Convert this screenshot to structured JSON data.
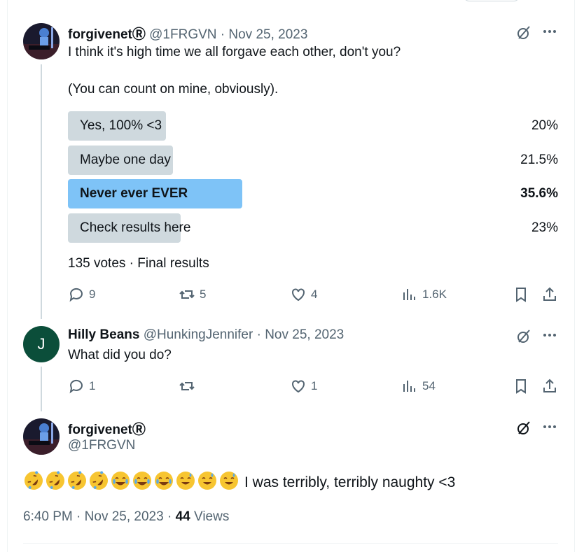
{
  "tweets": [
    {
      "name": "forgivenetⓇ",
      "handle": "@1FRGVN",
      "date": "Nov 25, 2023",
      "text_lines": [
        "I think it's high time we all forgave each other, don't you?",
        "(You can count on mine, obviously)."
      ],
      "poll": {
        "options": [
          {
            "label": "Yes, 100% <3",
            "percent": "20%",
            "value": 20,
            "winner": false
          },
          {
            "label": "Maybe one day",
            "percent": "21.5%",
            "value": 21.5,
            "winner": false
          },
          {
            "label": "Never ever EVER",
            "percent": "35.6%",
            "value": 35.6,
            "winner": true
          },
          {
            "label": "Check results here",
            "percent": "23%",
            "value": 23,
            "winner": false
          }
        ],
        "summary": "135 votes · Final results"
      },
      "stats": {
        "replies": "9",
        "retweets": "5",
        "likes": "4",
        "views": "1.6K"
      }
    },
    {
      "name": "Hilly Beans",
      "handle": "@HunkingJennifer",
      "date": "Nov 25, 2023",
      "avatar_letter": "J",
      "text": "What did you do?",
      "stats": {
        "replies": "1",
        "retweets": "",
        "likes": "1",
        "views": "54"
      }
    },
    {
      "name": "forgivenetⓇ",
      "handle": "@1FRGVN",
      "text": "I was terribly, terribly naughty <3",
      "emojis": [
        "rofl",
        "rofl",
        "rofl",
        "rofl",
        "joy",
        "joy",
        "joy",
        "sweat-smile",
        "sweat-smile",
        "sweat-smile"
      ],
      "time": "6:40 PM",
      "date": "Nov 25, 2023",
      "views_count": "44",
      "views_label": "Views"
    }
  ],
  "colors": {
    "accent": "#1d9bf0",
    "poll_winner": "#7ec3f7",
    "poll_bar": "#cfd9de",
    "muted": "#536471"
  }
}
